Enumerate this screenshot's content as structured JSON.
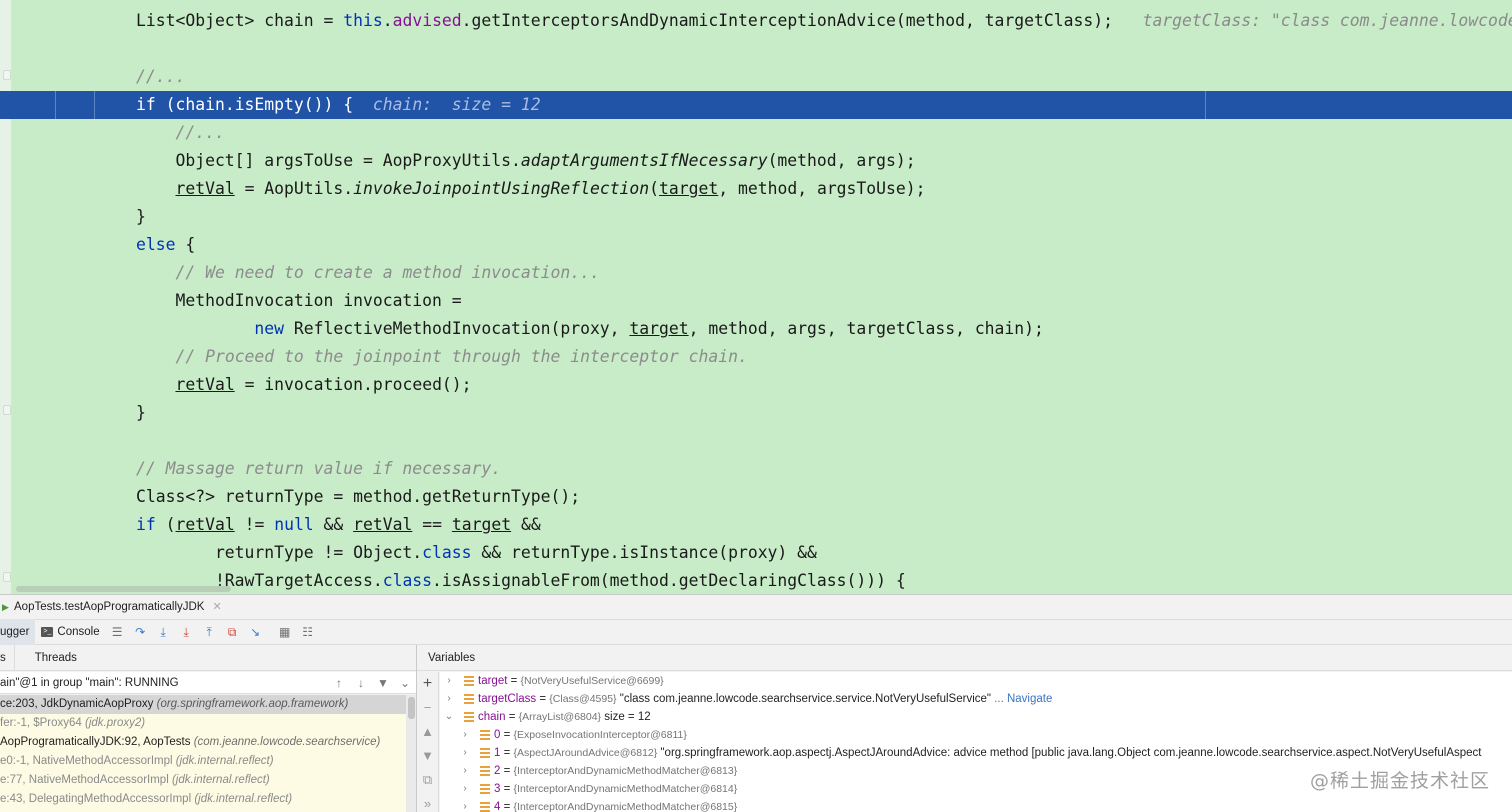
{
  "editor": {
    "lines": [
      {
        "segments": [
          {
            "t": "List<Object> chain = "
          },
          {
            "t": "this",
            "c": "kw"
          },
          {
            "t": "."
          },
          {
            "t": "advised",
            "c": "fld"
          },
          {
            "t": ".getInterceptorsAndDynamicInterceptionAdvice(method, targetClass);"
          },
          {
            "t": "   targetClass: \"class com.jeanne.lowcode.searchservice.service.NotVeryUsefulService\"",
            "c": "inl"
          }
        ]
      },
      {
        "segments": []
      },
      {
        "segments": [
          {
            "t": "//...",
            "c": "cmt"
          }
        ]
      },
      {
        "segments": [
          {
            "t": "if",
            "c": "kw"
          },
          {
            "t": " (chain.isEmpty()) {  "
          },
          {
            "t": "chain:  size = 12",
            "c": "inl"
          }
        ]
      },
      {
        "segments": [
          {
            "t": "    "
          },
          {
            "t": "//...",
            "c": "cmt"
          }
        ]
      },
      {
        "segments": [
          {
            "t": "    Object[] argsToUse = AopProxyUtils."
          },
          {
            "t": "adaptArgumentsIfNecessary",
            "c": "it"
          },
          {
            "t": "(method, args);"
          }
        ]
      },
      {
        "segments": [
          {
            "t": "    "
          },
          {
            "t": "retVal",
            "c": "ul"
          },
          {
            "t": " = AopUtils."
          },
          {
            "t": "invokeJoinpointUsingReflection",
            "c": "it"
          },
          {
            "t": "("
          },
          {
            "t": "target",
            "c": "ul"
          },
          {
            "t": ", method, argsToUse);"
          }
        ]
      },
      {
        "segments": [
          {
            "t": "}"
          }
        ]
      },
      {
        "segments": [
          {
            "t": "else",
            "c": "kw"
          },
          {
            "t": " {"
          }
        ]
      },
      {
        "segments": [
          {
            "t": "    "
          },
          {
            "t": "// We need to create a method invocation...",
            "c": "cmt"
          }
        ]
      },
      {
        "segments": [
          {
            "t": "    MethodInvocation invocation ="
          }
        ]
      },
      {
        "segments": [
          {
            "t": "            "
          },
          {
            "t": "new",
            "c": "kw"
          },
          {
            "t": " ReflectiveMethodInvocation(proxy, "
          },
          {
            "t": "target",
            "c": "ul"
          },
          {
            "t": ", method, args, targetClass, chain);"
          }
        ]
      },
      {
        "segments": [
          {
            "t": "    "
          },
          {
            "t": "// Proceed to the joinpoint through the interceptor chain.",
            "c": "cmt"
          }
        ]
      },
      {
        "segments": [
          {
            "t": "    "
          },
          {
            "t": "retVal",
            "c": "ul"
          },
          {
            "t": " = invocation.proceed();"
          }
        ]
      },
      {
        "segments": [
          {
            "t": "}"
          }
        ]
      },
      {
        "segments": []
      },
      {
        "segments": [
          {
            "t": "// Massage return value if necessary.",
            "c": "cmt"
          }
        ]
      },
      {
        "segments": [
          {
            "t": "Class<?> returnType = method.getReturnType();"
          }
        ]
      },
      {
        "segments": [
          {
            "t": "if",
            "c": "kw"
          },
          {
            "t": " ("
          },
          {
            "t": "retVal",
            "c": "ul"
          },
          {
            "t": " != "
          },
          {
            "t": "null",
            "c": "kw"
          },
          {
            "t": " && "
          },
          {
            "t": "retVal",
            "c": "ul"
          },
          {
            "t": " == "
          },
          {
            "t": "target",
            "c": "ul"
          },
          {
            "t": " &&"
          }
        ]
      },
      {
        "segments": [
          {
            "t": "        returnType != Object."
          },
          {
            "t": "class",
            "c": "kw"
          },
          {
            "t": " && returnType.isInstance(proxy) &&"
          }
        ]
      },
      {
        "segments": [
          {
            "t": "        !RawTargetAccess."
          },
          {
            "t": "class",
            "c": "kw"
          },
          {
            "t": ".isAssignableFrom(method.getDeclaringClass())) {"
          }
        ]
      }
    ],
    "current_line_index": 3
  },
  "debug": {
    "session_tab": "AopTests.testAopProgramaticallyJDK",
    "toolbar": {
      "debugger_tab": "ugger",
      "console_tab": "Console",
      "icons": [
        "menu-icon",
        "step-over-icon",
        "step-into-icon",
        "force-step-into-icon",
        "step-out-icon",
        "drop-frame-icon",
        "run-to-cursor-icon",
        "evaluate-icon",
        "trace-icon"
      ]
    },
    "frames": {
      "tabs": [
        "s",
        "Threads"
      ],
      "thread_selector": "ain\"@1 in group \"main\": RUNNING",
      "rows": [
        {
          "method": "ce:203, JdkDynamicAopProxy ",
          "pkg": "(org.springframework.aop.framework)",
          "kind": "sel"
        },
        {
          "method": "fer:-1, $Proxy64 ",
          "pkg": "(jdk.proxy2)",
          "kind": "lib"
        },
        {
          "method": "AopProgramaticallyJDK:92, AopTests ",
          "pkg": "(com.jeanne.lowcode.searchservice)",
          "kind": "proj"
        },
        {
          "method": "e0:-1, NativeMethodAccessorImpl ",
          "pkg": "(jdk.internal.reflect)",
          "kind": "lib"
        },
        {
          "method": "e:77, NativeMethodAccessorImpl ",
          "pkg": "(jdk.internal.reflect)",
          "kind": "lib"
        },
        {
          "method": "e:43, DelegatingMethodAccessorImpl ",
          "pkg": "(jdk.internal.reflect)",
          "kind": "lib"
        }
      ]
    },
    "variables": {
      "title": "Variables",
      "rows": [
        {
          "depth": 0,
          "expanded": false,
          "name": "target",
          "eq": " = ",
          "type": "{NotVeryUsefulService@6699}",
          "value": "",
          "link": ""
        },
        {
          "depth": 0,
          "expanded": false,
          "name": "targetClass",
          "eq": " = ",
          "type": "{Class@4595}",
          "value": " \"class com.jeanne.lowcode.searchservice.service.NotVeryUsefulService\"",
          "link": " ... Navigate"
        },
        {
          "depth": 0,
          "expanded": true,
          "name": "chain",
          "eq": " = ",
          "type": "{ArrayList@6804}",
          "value": "  size = 12",
          "link": ""
        },
        {
          "depth": 1,
          "expanded": false,
          "name": "0",
          "eq": " = ",
          "type": "{ExposeInvocationInterceptor@6811}",
          "value": "",
          "link": ""
        },
        {
          "depth": 1,
          "expanded": false,
          "name": "1",
          "eq": " = ",
          "type": "{AspectJAroundAdvice@6812}",
          "value": " \"org.springframework.aop.aspectj.AspectJAroundAdvice: advice method [public java.lang.Object com.jeanne.lowcode.searchservice.aspect.NotVeryUsefulAspect",
          "link": ""
        },
        {
          "depth": 1,
          "expanded": false,
          "name": "2",
          "eq": " = ",
          "type": "{InterceptorAndDynamicMethodMatcher@6813}",
          "value": "",
          "link": ""
        },
        {
          "depth": 1,
          "expanded": false,
          "name": "3",
          "eq": " = ",
          "type": "{InterceptorAndDynamicMethodMatcher@6814}",
          "value": "",
          "link": ""
        },
        {
          "depth": 1,
          "expanded": false,
          "name": "4",
          "eq": " = ",
          "type": "{InterceptorAndDynamicMethodMatcher@6815}",
          "value": "",
          "link": ""
        }
      ]
    }
  },
  "watermark": "@稀土掘金技术社区"
}
